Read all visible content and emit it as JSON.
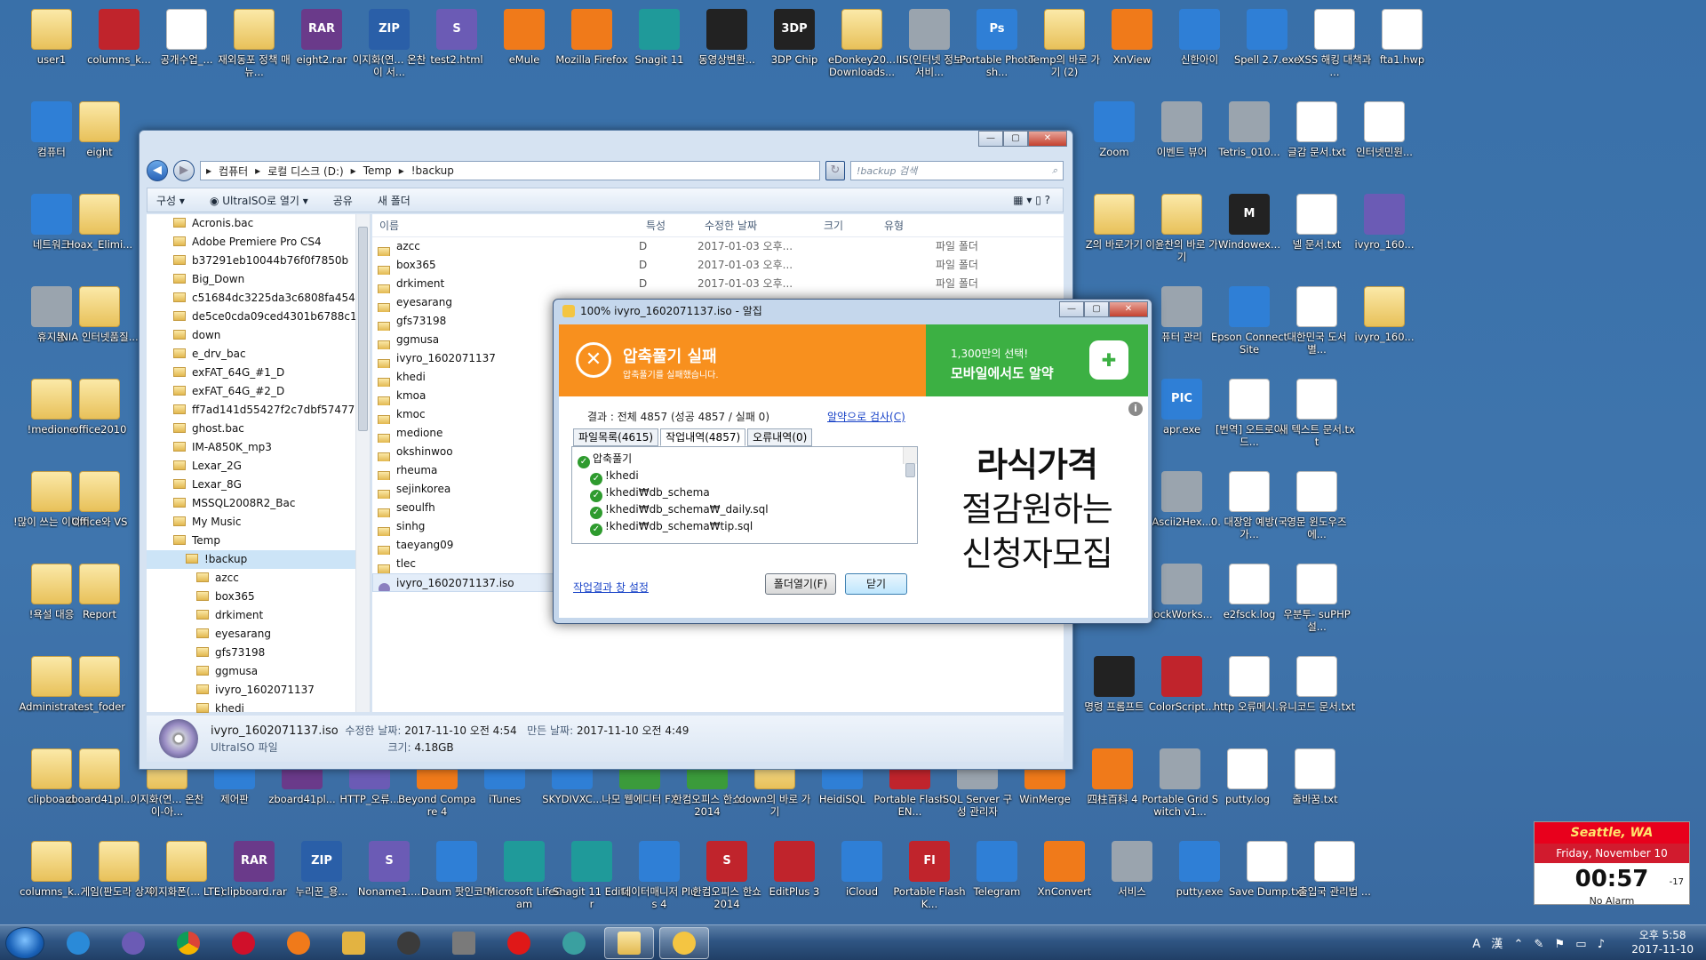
{
  "desktop_icons": [
    {
      "label": "user1",
      "type": "fold"
    },
    {
      "label": "columns_k...",
      "type": "t-red"
    },
    {
      "label": "공개수업_...",
      "type": "doc"
    },
    {
      "label": "재외동포 정책 매뉴...",
      "type": "fold"
    },
    {
      "label": "eight2.rar",
      "type": "t-rar",
      "glyph": "RAR"
    },
    {
      "label": "이지화(연... 온찬이 서...",
      "type": "t-zip",
      "glyph": "ZIP"
    },
    {
      "label": "test2.html",
      "type": "t-purple",
      "glyph": "S"
    },
    {
      "label": "eMule",
      "type": "t-orange"
    },
    {
      "label": "Mozilla Firefox",
      "type": "t-orange"
    },
    {
      "label": "Snagit 11",
      "type": "t-teal"
    },
    {
      "label": "동영상변환...",
      "type": "t-dark"
    },
    {
      "label": "3DP Chip",
      "type": "t-dark",
      "glyph": "3DP"
    },
    {
      "label": "eDonkey20... Downloads...",
      "type": "fold"
    },
    {
      "label": "IIS(인터넷 정보 서비...",
      "type": "t-gray"
    },
    {
      "label": "Portable Photosh...",
      "type": "t-blue",
      "glyph": "Ps"
    },
    {
      "label": "Temp의 바로 가기 (2)",
      "type": "fold"
    },
    {
      "label": "XnView",
      "type": "t-orange"
    },
    {
      "label": "신한아이",
      "type": "t-blue"
    },
    {
      "label": "Spell 2.7.exe",
      "type": "t-blue"
    },
    {
      "label": "XSS 해킹 대책과 ...",
      "type": "doc"
    },
    {
      "label": "fta1.hwp",
      "type": "doc"
    },
    {
      "label": "컴퓨터",
      "type": "t-blue"
    },
    {
      "label": "eight",
      "type": "fold"
    },
    {
      "label": "Zoom",
      "type": "t-blue"
    },
    {
      "label": "이벤트 뷰어",
      "type": "t-gray"
    },
    {
      "label": "Tetris_010...",
      "type": "t-gray"
    },
    {
      "label": "글감 문서.txt",
      "type": "doc"
    },
    {
      "label": "인터넷민원...",
      "type": "doc"
    },
    {
      "label": "네트워크",
      "type": "t-blue"
    },
    {
      "label": "Hoax_Elimi...",
      "type": "fold"
    },
    {
      "label": "Z의 바로가기",
      "type": "fold"
    },
    {
      "label": "이윤찬의 바로 가기",
      "type": "fold"
    },
    {
      "label": "Windowex...",
      "type": "t-dark",
      "glyph": "M"
    },
    {
      "label": "넬 문서.txt",
      "type": "doc"
    },
    {
      "label": "ivyro_160...",
      "type": "t-purple"
    },
    {
      "label": "휴지통",
      "type": "t-gray"
    },
    {
      "label": "NIA 인터넷품질...",
      "type": "fold"
    },
    {
      "label": "퓨터 관리",
      "type": "t-gray"
    },
    {
      "label": "Epson Connect Site",
      "type": "t-blue"
    },
    {
      "label": "대한민국 도서별...",
      "type": "doc"
    },
    {
      "label": "ivyro_160...",
      "type": "fold"
    },
    {
      "label": "!medione",
      "type": "fold"
    },
    {
      "label": "office2010",
      "type": "fold"
    },
    {
      "label": "apr.exe",
      "type": "t-blue",
      "glyph": "PIC"
    },
    {
      "label": "[번역] 오트로이드...",
      "type": "doc"
    },
    {
      "label": "새 텍스트 문서.txt",
      "type": "doc"
    },
    {
      "label": "!많이 쓰는 이미지",
      "type": "fold"
    },
    {
      "label": "Office와 VS",
      "type": "fold"
    },
    {
      "label": "Ascii2Hex...",
      "type": "t-gray"
    },
    {
      "label": "0. 대장암 예방(국가...",
      "type": "doc"
    },
    {
      "label": "영문 윈도우즈에...",
      "type": "doc"
    },
    {
      "label": "!욕설 대응",
      "type": "fold"
    },
    {
      "label": "Report",
      "type": "fold"
    },
    {
      "label": "lockWorks...",
      "type": "t-gray"
    },
    {
      "label": "e2fsck.log",
      "type": "doc"
    },
    {
      "label": "우분투- suPHP 설...",
      "type": "doc"
    },
    {
      "label": "Administra...",
      "type": "fold"
    },
    {
      "label": "test_foder",
      "type": "fold"
    },
    {
      "label": "명령 프롬프트",
      "type": "t-dark"
    },
    {
      "label": "ColorScript...",
      "type": "t-red"
    },
    {
      "label": "http 오류메시...",
      "type": "doc"
    },
    {
      "label": "유니코드 문서.txt",
      "type": "doc"
    },
    {
      "label": "clipboard",
      "type": "fold"
    },
    {
      "label": "zboard41pl...",
      "type": "fold"
    },
    {
      "label": "이지화(연... 온찬이-아...",
      "type": "fold"
    },
    {
      "label": "제어판",
      "type": "t-blue"
    },
    {
      "label": "zboard41pl...",
      "type": "t-rar"
    },
    {
      "label": "HTTP_오류...",
      "type": "t-purple"
    },
    {
      "label": "Beyond Compare 4",
      "type": "t-orange"
    },
    {
      "label": "iTunes",
      "type": "t-blue"
    },
    {
      "label": "SKYDIVXC...",
      "type": "t-blue"
    },
    {
      "label": "나모 웹에디터 FX",
      "type": "t-green"
    },
    {
      "label": "한컴오피스 한쇼 2014",
      "type": "t-green"
    },
    {
      "label": "down의 바로 가기",
      "type": "fold"
    },
    {
      "label": "HeidiSQL",
      "type": "t-blue"
    },
    {
      "label": "Portable Flash EN...",
      "type": "t-red"
    },
    {
      "label": "SQL Server 구성 관리자",
      "type": "t-gray"
    },
    {
      "label": "WinMerge",
      "type": "t-orange"
    },
    {
      "label": "四柱百科 4",
      "type": "t-orange"
    },
    {
      "label": "Portable Grid Switch v1...",
      "type": "t-gray"
    },
    {
      "label": "putty.log",
      "type": "doc"
    },
    {
      "label": "줄바꿈.txt",
      "type": "doc"
    },
    {
      "label": "columns_k...",
      "type": "fold"
    },
    {
      "label": "게임(판도라 상자)",
      "type": "fold"
    },
    {
      "label": "이지화폰(... LTE)",
      "type": "fold"
    },
    {
      "label": "clipboard.rar",
      "type": "t-rar",
      "glyph": "RAR"
    },
    {
      "label": "누리꾼_용...",
      "type": "t-zip",
      "glyph": "ZIP"
    },
    {
      "label": "Noname1....",
      "type": "t-purple",
      "glyph": "S"
    },
    {
      "label": "Daum 팟인코더",
      "type": "t-blue"
    },
    {
      "label": "Microsoft LifeCam",
      "type": "t-teal"
    },
    {
      "label": "Snagit 11 Editor",
      "type": "t-teal"
    },
    {
      "label": "데이터매니저 Plus 4",
      "type": "t-blue"
    },
    {
      "label": "한컴오피스 한쇼 2014",
      "type": "t-red",
      "glyph": "S"
    },
    {
      "label": "EditPlus 3",
      "type": "t-red"
    },
    {
      "label": "iCloud",
      "type": "t-blue"
    },
    {
      "label": "Portable Flash K...",
      "type": "t-red",
      "glyph": "Fl"
    },
    {
      "label": "Telegram",
      "type": "t-blue"
    },
    {
      "label": "XnConvert",
      "type": "t-orange"
    },
    {
      "label": "서비스",
      "type": "t-gray"
    },
    {
      "label": "putty.exe",
      "type": "t-blue"
    },
    {
      "label": "Save Dump.txt",
      "type": "doc"
    },
    {
      "label": "출입국 관리법 ...",
      "type": "doc"
    }
  ],
  "explorer": {
    "path": [
      "컴퓨터",
      "로컬 디스크 (D:)",
      "Temp",
      "!backup"
    ],
    "search_placeholder": "!backup 검색",
    "toolbar": {
      "organize": "구성",
      "open_with": "UltraISO로 열기",
      "share": "공유",
      "new_folder": "새 폴더"
    },
    "nav_tree": [
      "Acronis.bac",
      "Adobe Premiere Pro CS4",
      "b37291eb10044b76f0f7850b",
      "Big_Down",
      "c51684dc3225da3c6808fa454bb8",
      "de5ce0cda09ced4301b6788c16a9",
      "down",
      "e_drv_bac",
      "exFAT_64G_#1_D",
      "exFAT_64G_#2_D",
      "ff7ad141d55427f2c7dbf5747703c",
      "ghost.bac",
      "IM-A850K_mp3",
      "Lexar_2G",
      "Lexar_8G",
      "MSSQL2008R2_Bac",
      "My Music",
      "Temp",
      "!backup",
      "azcc",
      "box365",
      "drkiment",
      "eyesarang",
      "gfs73198",
      "ggmusa",
      "ivyro_1602071137",
      "khedi"
    ],
    "columns": {
      "name": "이름",
      "attr": "특성",
      "modified": "수정한 날짜",
      "size": "크기",
      "type": "유형"
    },
    "files": [
      {
        "name": "azcc",
        "attr": "D",
        "modified": "2017-01-03 오후...",
        "size": "",
        "type": "파일 폴더"
      },
      {
        "name": "box365",
        "attr": "D",
        "modified": "2017-01-03 오후...",
        "size": "",
        "type": "파일 폴더"
      },
      {
        "name": "drkiment",
        "attr": "D",
        "modified": "2017-01-03 오후...",
        "size": "",
        "type": "파일 폴더"
      },
      {
        "name": "eyesarang",
        "attr": "",
        "modified": "",
        "size": "",
        "type": ""
      },
      {
        "name": "gfs73198",
        "attr": "",
        "modified": "",
        "size": "",
        "type": ""
      },
      {
        "name": "ggmusa",
        "attr": "",
        "modified": "",
        "size": "",
        "type": ""
      },
      {
        "name": "ivyro_1602071137",
        "attr": "",
        "modified": "",
        "size": "",
        "type": ""
      },
      {
        "name": "khedi",
        "attr": "",
        "modified": "",
        "size": "",
        "type": ""
      },
      {
        "name": "kmoa",
        "attr": "",
        "modified": "",
        "size": "",
        "type": ""
      },
      {
        "name": "kmoc",
        "attr": "",
        "modified": "",
        "size": "",
        "type": ""
      },
      {
        "name": "medione",
        "attr": "",
        "modified": "",
        "size": "",
        "type": ""
      },
      {
        "name": "okshinwoo",
        "attr": "",
        "modified": "",
        "size": "",
        "type": ""
      },
      {
        "name": "rheuma",
        "attr": "",
        "modified": "",
        "size": "",
        "type": ""
      },
      {
        "name": "sejinkorea",
        "attr": "",
        "modified": "",
        "size": "",
        "type": ""
      },
      {
        "name": "seoulfh",
        "attr": "",
        "modified": "",
        "size": "",
        "type": ""
      },
      {
        "name": "sinhg",
        "attr": "",
        "modified": "",
        "size": "",
        "type": ""
      },
      {
        "name": "taeyang09",
        "attr": "",
        "modified": "",
        "size": "",
        "type": ""
      },
      {
        "name": "tlec",
        "attr": "",
        "modified": "",
        "size": "",
        "type": ""
      },
      {
        "name": "ivyro_1602071137.iso",
        "attr": "",
        "modified": "",
        "size": "",
        "type": "",
        "selected": true
      }
    ],
    "status": {
      "filename": "ivyro_1602071137.iso",
      "modified_label": "수정한 날짜:",
      "modified": "2017-11-10 오전 4:54",
      "created_label": "만든 날짜:",
      "created": "2017-11-10 오전 4:49",
      "filetype": "UltraISO 파일",
      "size_label": "크기:",
      "size": "4.18GB"
    }
  },
  "dialog": {
    "title": "100% ivyro_1602071137.iso - 알집",
    "fail_title": "압축풀기 실패",
    "fail_sub": "압축풀기를 실패했습니다.",
    "promo_line1": "1,300만의 선택!",
    "promo_line2": "모바일에서도 알약",
    "result": "결과 : 전체 4857 (성공 4857 / 실패 0)",
    "check_link": "알약으로 검사(C)",
    "tabs": [
      "파일목록(4615)",
      "작업내역(4857)",
      "오류내역(0)"
    ],
    "log": [
      "압축풀기",
      "!khedi",
      "!khedi₩db_schema",
      "!khedi₩db_schema₩_daily.sql",
      "!khedi₩db_schema₩tip.sql"
    ],
    "settings_link": "작업결과 창 설정",
    "open_folder": "폴더열기(F)",
    "close": "닫기",
    "ad_lines": [
      "라식가격",
      "절감원하는",
      "신청자모집"
    ]
  },
  "clock": {
    "city": "Seattle, WA",
    "date": "Friday, November 10",
    "time": "00:57",
    "seconds": "-17",
    "alarm": "No Alarm"
  },
  "tray": {
    "time": "오후 5:58",
    "date": "2017-11-10",
    "ime": "A 漢"
  }
}
